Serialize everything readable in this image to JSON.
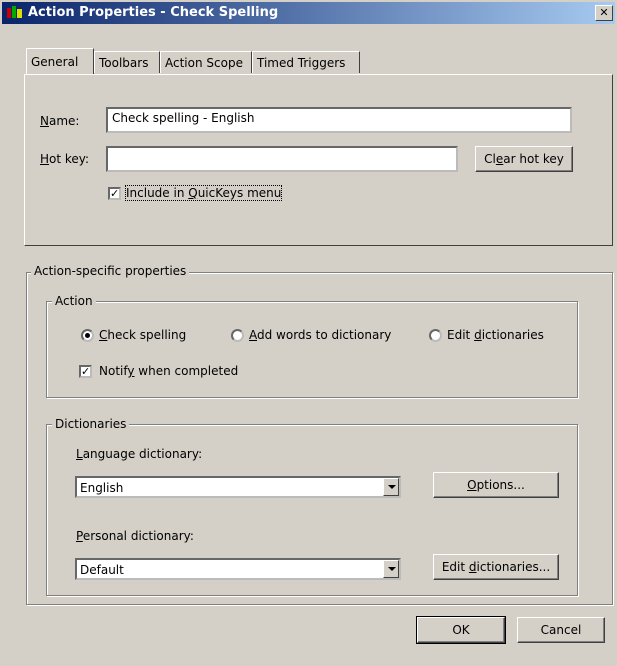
{
  "window": {
    "title": "Action Properties - Check Spelling",
    "close_glyph": "✕"
  },
  "tabs": [
    {
      "label": "General",
      "active": true
    },
    {
      "label": "Toolbars",
      "active": false
    },
    {
      "label": "Action Scope",
      "active": false
    },
    {
      "label": "Timed Triggers",
      "active": false
    }
  ],
  "general": {
    "name_label_ul": "N",
    "name_label_rest": "ame:",
    "name_value": "Check spelling - English",
    "hotkey_label_ul": "H",
    "hotkey_label_rest": "ot key:",
    "hotkey_value": "",
    "clear_hotkey_pre": "Cl",
    "clear_hotkey_ul": "e",
    "clear_hotkey_post": "ar hot key",
    "include_pre": "Include in ",
    "include_ul": "Q",
    "include_post": "uicKeys menu",
    "include_checked": true
  },
  "action_specific": {
    "legend": "Action-specific properties",
    "action_group": {
      "legend": "Action",
      "options": [
        {
          "ul": "C",
          "rest": "heck spelling",
          "checked": true
        },
        {
          "ul": "A",
          "rest": "dd words to dictionary",
          "checked": false
        },
        {
          "pre": "Edit ",
          "ul": "d",
          "rest": "ictionaries",
          "checked": false
        }
      ],
      "notify_pre": "Notif",
      "notify_ul": "y",
      "notify_post": " when completed",
      "notify_checked": true
    },
    "dictionaries_group": {
      "legend": "Dictionaries",
      "language_label_ul": "L",
      "language_label_rest": "anguage dictionary:",
      "language_value": "English",
      "options_ul": "O",
      "options_rest": "ptions...",
      "personal_label_ul": "P",
      "personal_label_rest": "ersonal dictionary:",
      "personal_value": "Default",
      "edit_dict_pre": "Edit ",
      "edit_dict_ul": "d",
      "edit_dict_post": "ictionaries..."
    }
  },
  "footer": {
    "ok_label": "OK",
    "cancel_label": "Cancel"
  }
}
